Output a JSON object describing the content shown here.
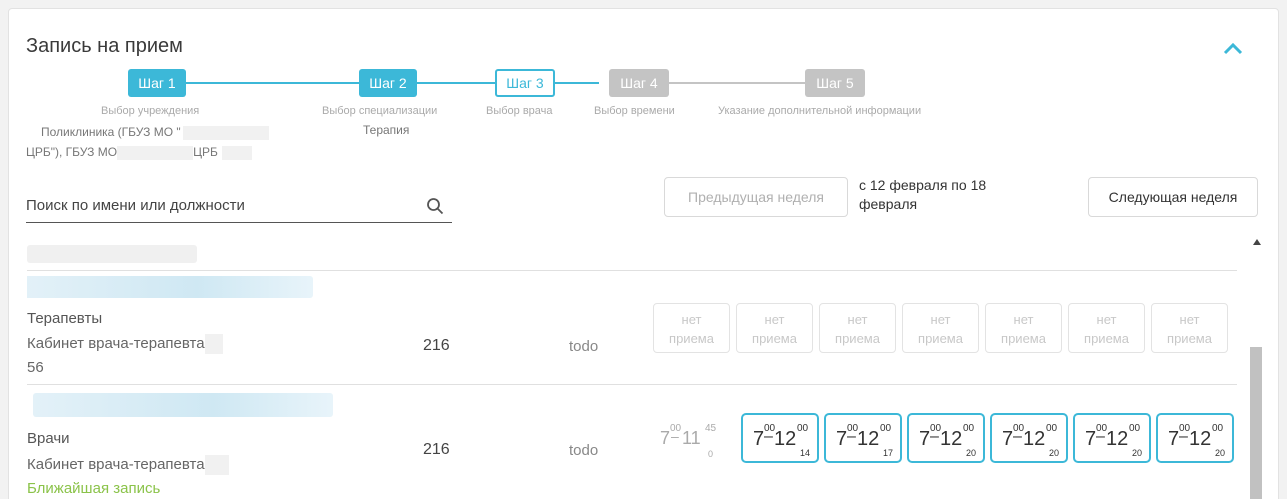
{
  "header": {
    "title": "Запись на прием"
  },
  "steps": [
    {
      "badge": "Шаг 1",
      "label": "Выбор учреждения",
      "state": "done"
    },
    {
      "badge": "Шаг 2",
      "label": "Выбор специализации",
      "state": "done"
    },
    {
      "badge": "Шаг 3",
      "label": "Выбор врача",
      "state": "current"
    },
    {
      "badge": "Шаг 4",
      "label": "Выбор времени",
      "state": "todo"
    },
    {
      "badge": "Шаг 5",
      "label": "Указание дополнительной информации",
      "state": "todo"
    }
  ],
  "selection": {
    "institution_line1": "Поликлиника (ГБУЗ МО \"",
    "institution_line2a": "ЦРБ\"), ГБУЗ МО",
    "institution_line2b": "ЦРБ",
    "specialization": "Терапия"
  },
  "search": {
    "placeholder": "Поиск по имени или должности"
  },
  "week": {
    "prev_label": "Предыдущая неделя",
    "range_line1": "с 12 февраля по 18",
    "range_line2": "февраля",
    "next_label": "Следующая неделя"
  },
  "doctors": [
    {
      "specialty": "Терапевты",
      "room": "Кабинет врача-терапевта",
      "room_suffix": "56",
      "number": "216",
      "status": "todo",
      "days": [
        "нет приема",
        "нет приема",
        "нет приема",
        "нет приема",
        "нет приема",
        "нет приема",
        "нет приема"
      ]
    },
    {
      "specialty": "Врачи",
      "room": "Кабинет врача-терапевта",
      "nearest": "Ближайшая запись",
      "number": "216",
      "status": "todo",
      "slots": [
        {
          "from": "7",
          "from_min": "00",
          "to": "11",
          "to_min": "45",
          "count": "0"
        },
        {
          "from": "7",
          "from_min": "00",
          "to": "12",
          "to_min": "00",
          "count": "14"
        },
        {
          "from": "7",
          "from_min": "00",
          "to": "12",
          "to_min": "00",
          "count": "17"
        },
        {
          "from": "7",
          "from_min": "00",
          "to": "12",
          "to_min": "00",
          "count": "20"
        },
        {
          "from": "7",
          "from_min": "00",
          "to": "12",
          "to_min": "00",
          "count": "20"
        },
        {
          "from": "7",
          "from_min": "00",
          "to": "12",
          "to_min": "00",
          "count": "20"
        },
        {
          "from": "7",
          "from_min": "00",
          "to": "12",
          "to_min": "00",
          "count": "20"
        }
      ]
    }
  ],
  "colors": {
    "accent": "#3cb8d8",
    "inactive_step": "#c4c4c4",
    "nearest": "#8bc34a"
  },
  "icons": {
    "collapse": "chevron-up-icon",
    "search": "search-icon"
  }
}
